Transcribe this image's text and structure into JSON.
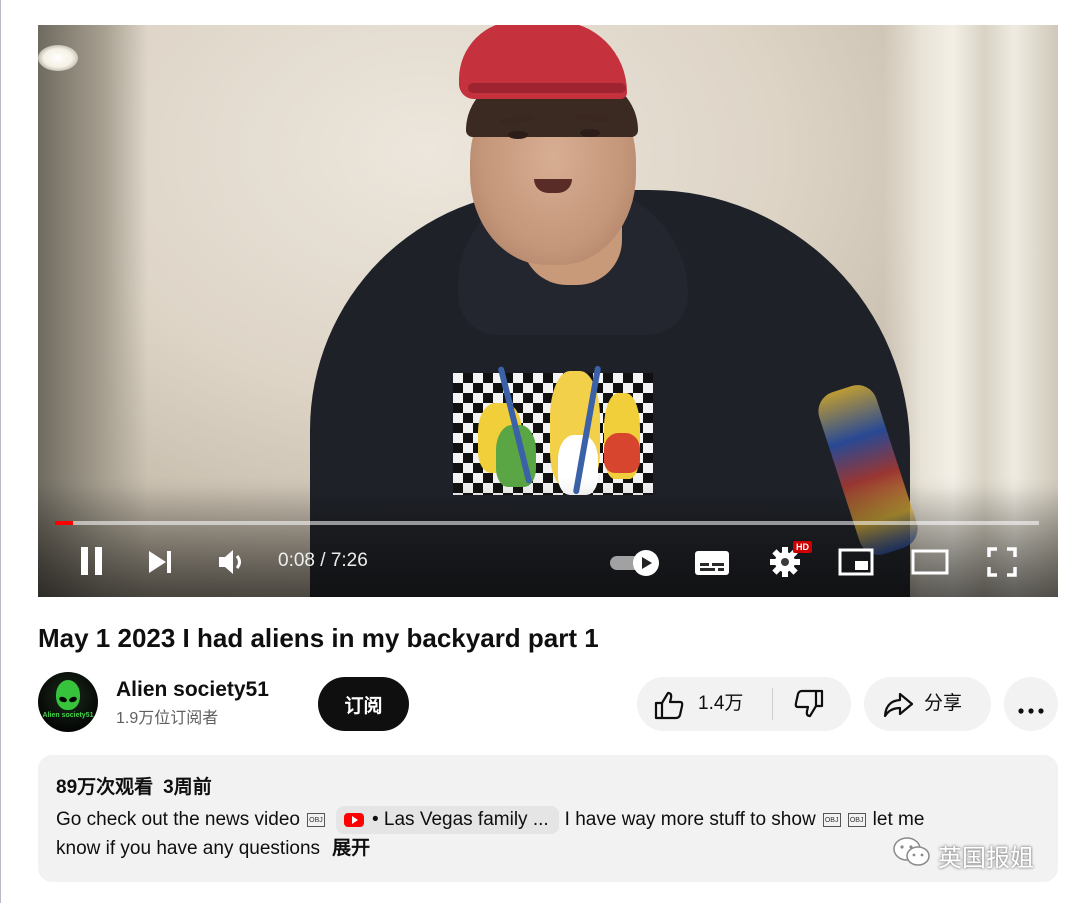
{
  "player": {
    "time_current": "0:08",
    "time_total": "7:26",
    "time_display": "0:08 / 7:26",
    "progress_fraction": 0.018,
    "hd_badge": "HD",
    "colors": {
      "progress": "#ff0000",
      "hd_badge": "#cc0000"
    },
    "icons": [
      "pause-icon",
      "next-icon",
      "volume-icon",
      "autoplay-toggle-icon",
      "subtitles-icon",
      "settings-gear-icon",
      "miniplayer-icon",
      "theater-mode-icon",
      "fullscreen-icon"
    ]
  },
  "video": {
    "title": "May 1 2023 I had aliens in my backyard part 1"
  },
  "channel": {
    "name": "Alien society51",
    "subscribers": "1.9万位订阅者",
    "avatar_text": "Alien society51"
  },
  "actions": {
    "subscribe_label": "订阅",
    "like_count": "1.4万",
    "share_label": "分享",
    "icons": [
      "like-icon",
      "dislike-icon",
      "share-icon",
      "more-icon"
    ]
  },
  "description": {
    "views": "89万次观看",
    "date": "3周前",
    "text_before_chip": "Go check out the news video",
    "obj_glyph": "OBJ",
    "chip_text": "• Las Vegas family ...",
    "text_after_chip": "I have way more stuff to show",
    "text_after_glyphs": "let me",
    "line2": "know if you have any questions",
    "expand_label": "展开"
  },
  "watermark": {
    "text": "英国报姐"
  }
}
